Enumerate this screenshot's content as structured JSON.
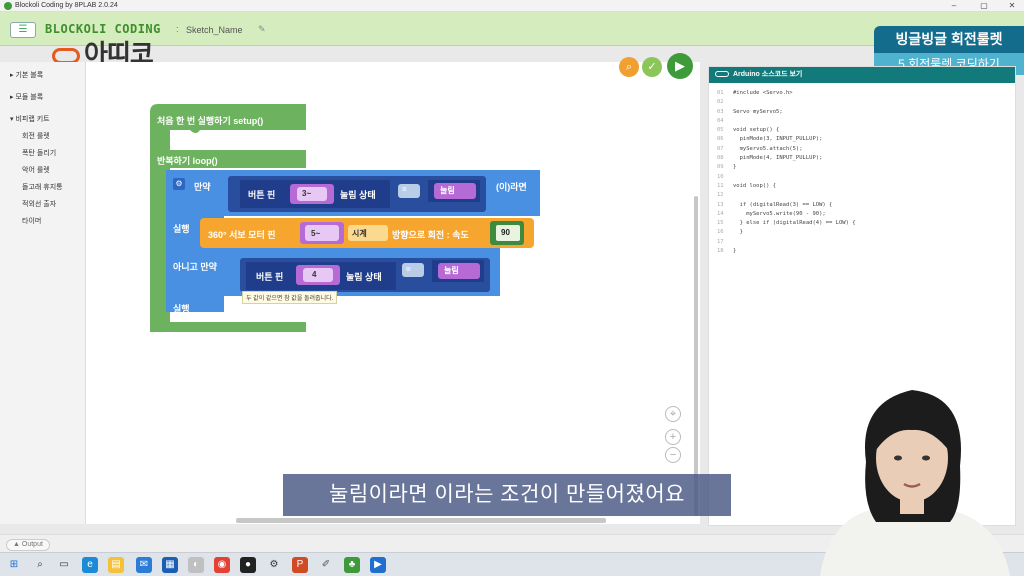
{
  "window": {
    "title": "Blockoli Coding by 8PLAB 2.0.24",
    "minimize": "–",
    "maximize": "▢",
    "close": "✕"
  },
  "header": {
    "logo": "BLOCKOLI CODING",
    "sketch_separator": ":",
    "sketch_name": "Sketch_Name",
    "menu_icon": "list-icon",
    "edit_icon": "pencil-icon"
  },
  "watermark": {
    "brand": "아띠코"
  },
  "course": {
    "title": "빙글빙글 회전룰렛",
    "subtitle": "5.회전룰렛 코딩하기"
  },
  "sidebar": {
    "categories": [
      {
        "label": "기본 블록"
      },
      {
        "label": "모듈 블록"
      },
      {
        "label": "비피랩 키트"
      }
    ],
    "sub_items": [
      {
        "label": "회전 룰렛"
      },
      {
        "label": "폭탄 돌리기"
      },
      {
        "label": "악어 룰렛"
      },
      {
        "label": "돌고래 휴지통"
      },
      {
        "label": "적외선 출자"
      },
      {
        "label": "타이머"
      }
    ]
  },
  "workspace": {
    "toolbar_icons": [
      "search-icon",
      "check-icon",
      "play-icon"
    ],
    "zoom_icons": [
      "target-icon",
      "plus-icon",
      "minus-icon"
    ],
    "blocks": {
      "setup_label": "처음 한 번 실행하기 setup()",
      "loop_label": "반복하기 loop()",
      "if_label": "만약",
      "if_then": "(이)라면",
      "button_pin": "버튼 핀",
      "pin1": "3~",
      "pressed_state": "눌림 상태",
      "equals": "=",
      "pressed_value": "눌림",
      "do_label": "실행",
      "servo_label": "360° 서보 모터 핀",
      "servo_pin": "5~",
      "direction": "시계",
      "rotate_label": "방향으로 회전 : 속도",
      "speed": "90",
      "elseif_label": "아니고 만약",
      "pin2": "4",
      "do2_label": "실행",
      "tooltip": "두 값이 같으면 참 값을 돌려줍니다."
    }
  },
  "code_panel": {
    "title": "Arduino 소스코드 보기",
    "lines": [
      {
        "n": "01",
        "t": "#include <Servo.h>"
      },
      {
        "n": "02",
        "t": ""
      },
      {
        "n": "03",
        "t": "Servo myServo5;"
      },
      {
        "n": "04",
        "t": ""
      },
      {
        "n": "05",
        "t": "void setup() {"
      },
      {
        "n": "06",
        "t": "  pinMode(3, INPUT_PULLUP);"
      },
      {
        "n": "07",
        "t": "  myServo5.attach(5);"
      },
      {
        "n": "08",
        "t": "  pinMode(4, INPUT_PULLUP);"
      },
      {
        "n": "09",
        "t": "}"
      },
      {
        "n": "10",
        "t": ""
      },
      {
        "n": "11",
        "t": "void loop() {"
      },
      {
        "n": "12",
        "t": ""
      },
      {
        "n": "13",
        "t": "  if (digitalRead(3) == LOW) {"
      },
      {
        "n": "14",
        "t": "    myServo5.write(90 - 90);"
      },
      {
        "n": "15",
        "t": "  } else if (digitalRead(4) == LOW) {"
      },
      {
        "n": "16",
        "t": "  }"
      },
      {
        "n": "17",
        "t": ""
      },
      {
        "n": "18",
        "t": "}"
      }
    ]
  },
  "output": {
    "label": "Output",
    "icon": "chevron-up-icon"
  },
  "subtitle": "눌림이라면 이라는 조건이 만들어졌어요",
  "colors": {
    "header": "#d5ecbe",
    "green_block": "#6db35f",
    "blue_block": "#4a90e2",
    "orange_block": "#f6a52e",
    "dark_blue": "#1f3d8a",
    "purple": "#b56ad6",
    "teal": "#127a7a"
  }
}
